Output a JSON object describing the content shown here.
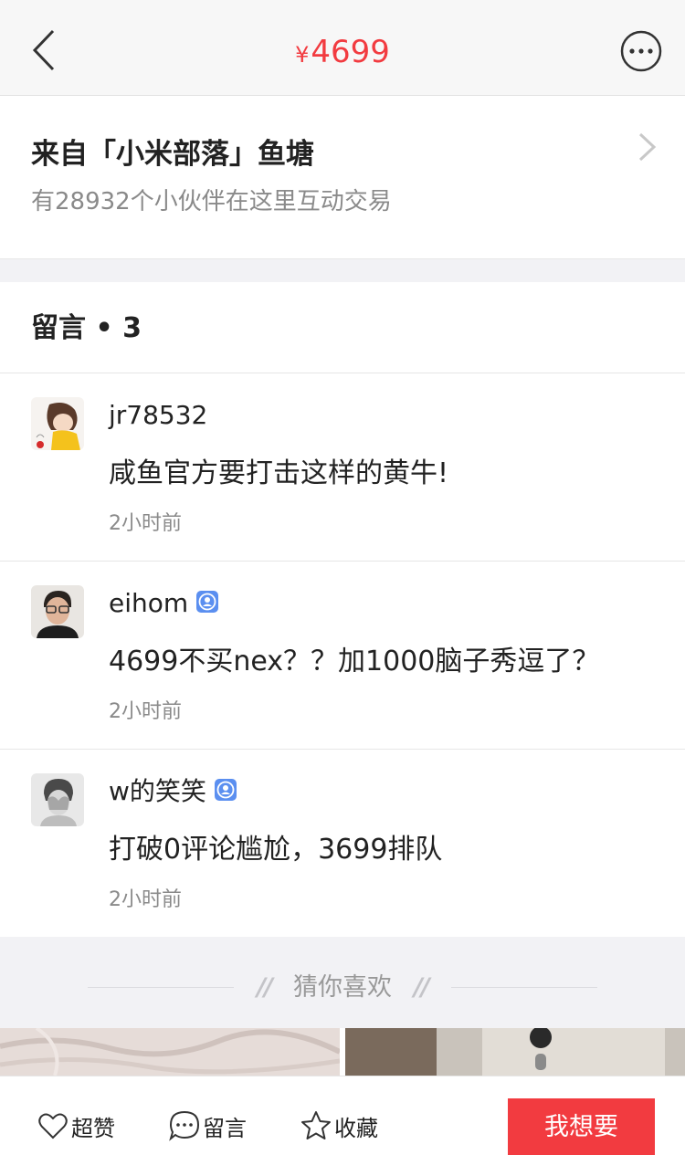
{
  "header": {
    "price_symbol": "¥",
    "price_value": "4699",
    "accent_color": "#f23b40",
    "back_icon": "chevron-left-icon",
    "more_icon": "more-dots-icon"
  },
  "pond": {
    "title": "来自「小米部落」鱼塘",
    "subtitle": "有28932个小伙伴在这里互动交易"
  },
  "comments": {
    "title": "留言 • 3",
    "items": [
      {
        "username": "jr78532",
        "verified": false,
        "text": "咸鱼官方要打击这样的黄牛!",
        "time": "2小时前"
      },
      {
        "username": "eihom",
        "verified": true,
        "text": "4699不买nex？？加1000脑子秀逗了？",
        "time": "2小时前"
      },
      {
        "username": "w的笑笑",
        "verified": true,
        "text": "打破0评论尴尬，3699排队",
        "time": "2小时前"
      }
    ]
  },
  "guess": {
    "title": "猜你喜欢"
  },
  "bottom_bar": {
    "like_label": "超赞",
    "comment_label": "留言",
    "favorite_label": "收藏",
    "want_label": "我想要"
  }
}
